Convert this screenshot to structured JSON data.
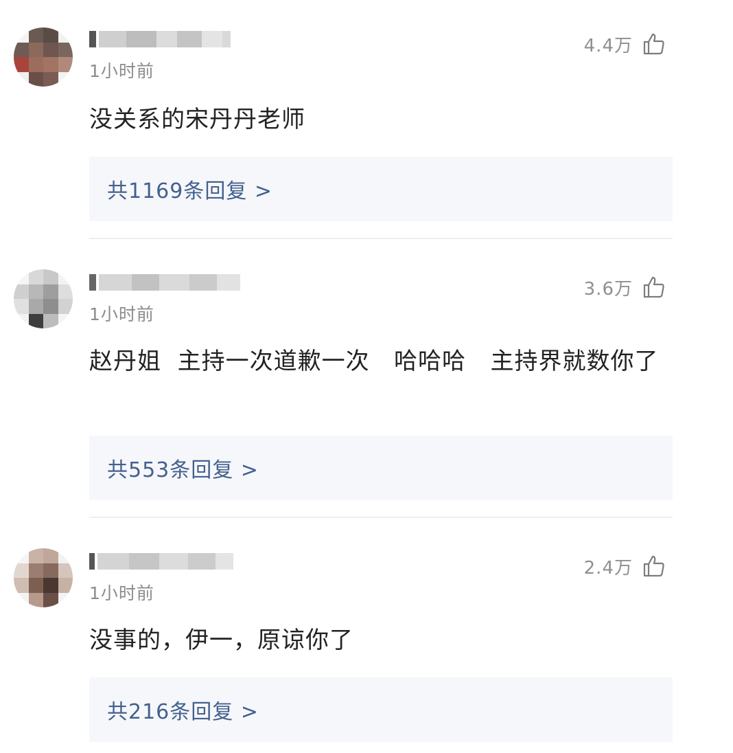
{
  "comments": [
    {
      "username": "",
      "time": "1小时前",
      "likes": "4.4万",
      "text": "没关系的宋丹丹老师",
      "replies": "共1169条回复 >",
      "avatar_colors": [
        "#f4f4f4",
        "#6b5a52",
        "#5a4c45",
        "#f1f1f1",
        "#6e5c54",
        "#8b6a5b",
        "#6f5650",
        "#7a665e",
        "#a9443d",
        "#9c6d5e",
        "#a37363",
        "#b0897a",
        "#f0f0f0",
        "#6a4f48",
        "#7b5b52",
        "#f3f3f3"
      ]
    },
    {
      "username": "",
      "time": "1小时前",
      "likes": "3.6万",
      "text": "赵丹姐  主持一次道歉一次   哈哈哈   主持界就数你了",
      "replies": "共553条回复 >",
      "avatar_colors": [
        "#f5f5f5",
        "#d8d8d8",
        "#c8c8c8",
        "#f3f3f3",
        "#cfcfcf",
        "#b8b8b8",
        "#9e9e9e",
        "#dedede",
        "#e0e0e0",
        "#a9a9a9",
        "#8e8e8e",
        "#d2d2d2",
        "#f2f2f2",
        "#3e3e3e",
        "#bcbcbc",
        "#f4f4f4"
      ]
    },
    {
      "username": "",
      "time": "1小时前",
      "likes": "2.4万",
      "text": "没事的，伊一，原谅你了",
      "replies": "共216条回复 >",
      "avatar_colors": [
        "#f5f5f5",
        "#c9b3a6",
        "#bfa79a",
        "#f2f2f2",
        "#e2d7d0",
        "#9c7e70",
        "#866a5e",
        "#d5c5bc",
        "#d0bcb0",
        "#7d5f52",
        "#4a3730",
        "#c7b1a5",
        "#f3f3f3",
        "#b79a8c",
        "#6b5047",
        "#f4f4f4"
      ]
    }
  ],
  "colors": {
    "reply_link": "#43608f",
    "reply_box_bg": "#f6f7fa",
    "time_text": "#8c8c8c",
    "body_text": "#222222"
  }
}
